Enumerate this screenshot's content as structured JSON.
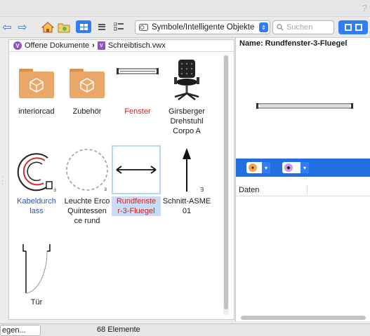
{
  "toolbar": {
    "library_select_label": "Symbole/Intelligente Objekte",
    "search_placeholder": "Suchen"
  },
  "breadcrumb": {
    "root_label": "Offene Dokumente",
    "separator": "›",
    "file_label": "Schreibtisch.vwx",
    "root_badge": "V",
    "file_badge": "V"
  },
  "items": [
    {
      "label": "interiorcad",
      "kind": "folder"
    },
    {
      "label": "Zubehör",
      "kind": "folder"
    },
    {
      "label": "Fenster",
      "kind": "window-symbol",
      "color": "red"
    },
    {
      "label": "Girsberger Drehstuhl Corpo A",
      "kind": "chair"
    },
    {
      "label": "Kabeldurch lass",
      "kind": "cable-port",
      "color": "blue"
    },
    {
      "label": "Leuchte Erco Quintessen ce rund",
      "kind": "lamp"
    },
    {
      "label": "Rundfenste r-3-Fluegel",
      "kind": "round-window",
      "color": "red",
      "selected": true
    },
    {
      "label": "Schnitt-ASME 01",
      "kind": "section-marker"
    },
    {
      "label": "Tür",
      "kind": "door"
    }
  ],
  "preview": {
    "name_text": "Name: Rundfenster-3-Fluegel"
  },
  "data_panel": {
    "header_label": "Daten"
  },
  "status": {
    "left_button_label": "egen...",
    "count_text": "68 Elemente"
  },
  "colors": {
    "accent": "#2d7ef7",
    "selection_bg": "#c8dcf5",
    "red_label": "#cc2222",
    "blue_label": "#2a52c8",
    "folder": "#eaa868"
  }
}
